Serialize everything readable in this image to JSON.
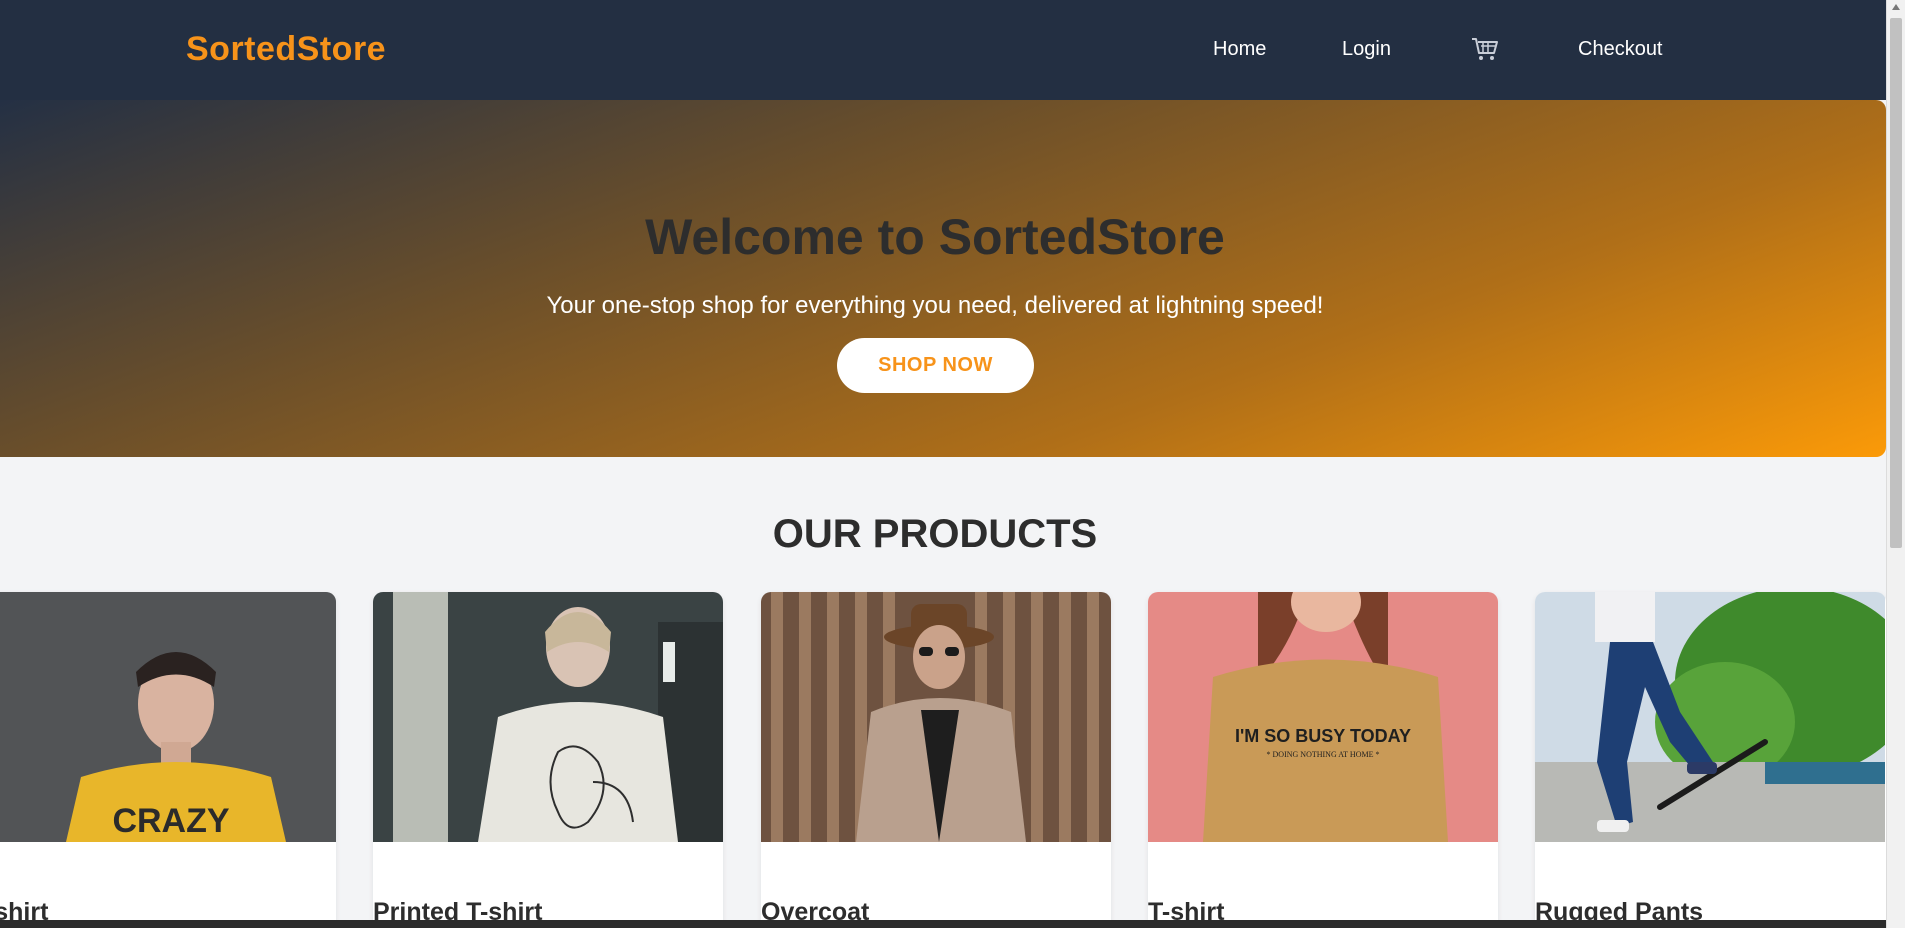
{
  "nav": {
    "brand": "SortedStore",
    "links": {
      "home": "Home",
      "login": "Login",
      "checkout": "Checkout"
    },
    "cart_icon": "cart-icon"
  },
  "hero": {
    "title": "Welcome to SortedStore",
    "subtitle": "Your one-stop shop for everything you need, delivered at lightning speed!",
    "cta": "SHOP NOW"
  },
  "products": {
    "heading": "OUR PRODUCTS",
    "items": [
      {
        "name": "T-shirt"
      },
      {
        "name": "Printed T-shirt"
      },
      {
        "name": "Overcoat"
      },
      {
        "name": "T-shirt"
      },
      {
        "name": "Rugged Pants"
      }
    ]
  },
  "colors": {
    "accent": "#f7931a",
    "navbar": "#232f42",
    "page_bg": "#f3f4f6"
  }
}
